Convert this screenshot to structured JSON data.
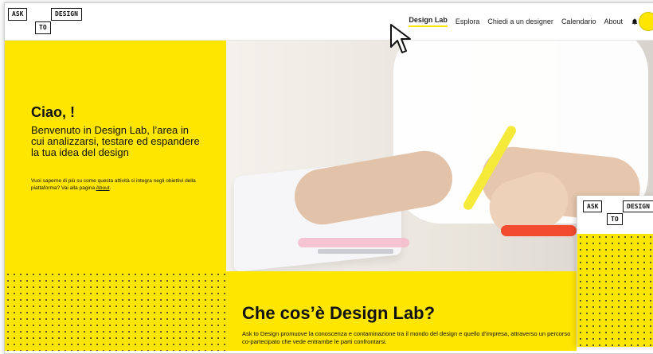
{
  "brand": {
    "logo_parts": {
      "ask": "ASK",
      "to": "TO",
      "design": "DESIGN"
    }
  },
  "nav": {
    "items": [
      {
        "label": "Design Lab",
        "active": true
      },
      {
        "label": "Esplora"
      },
      {
        "label": "Chiedi a un designer"
      },
      {
        "label": "Calendario"
      },
      {
        "label": "About"
      }
    ],
    "icons": {
      "notifications": "bell-icon",
      "avatar": "avatar-circle"
    },
    "accent_color": "#FFE600"
  },
  "hero": {
    "greeting": "Ciao, !",
    "lead": "Benvenuto in Design Lab, l’area in cui analizzarsi, testare ed espandere la tua idea del design",
    "small_prefix": "Vuoi saperne di più su come questa attività si integra negli obiettivi della piattaforma? Vai alla pagina ",
    "about_link": "About",
    "small_suffix": "."
  },
  "section": {
    "title": "Che cos’è Design Lab?",
    "text": "Ask to Design promuove la conoscenza e contaminazione tra il mondo del design e quello d’impresa, attraverso un percorso co-partecipato che vede entrambe le parti confrontarsi."
  },
  "overlay_card": {
    "logo_parts": {
      "ask": "ASK",
      "to": "TO",
      "design": "DESIGN"
    }
  }
}
